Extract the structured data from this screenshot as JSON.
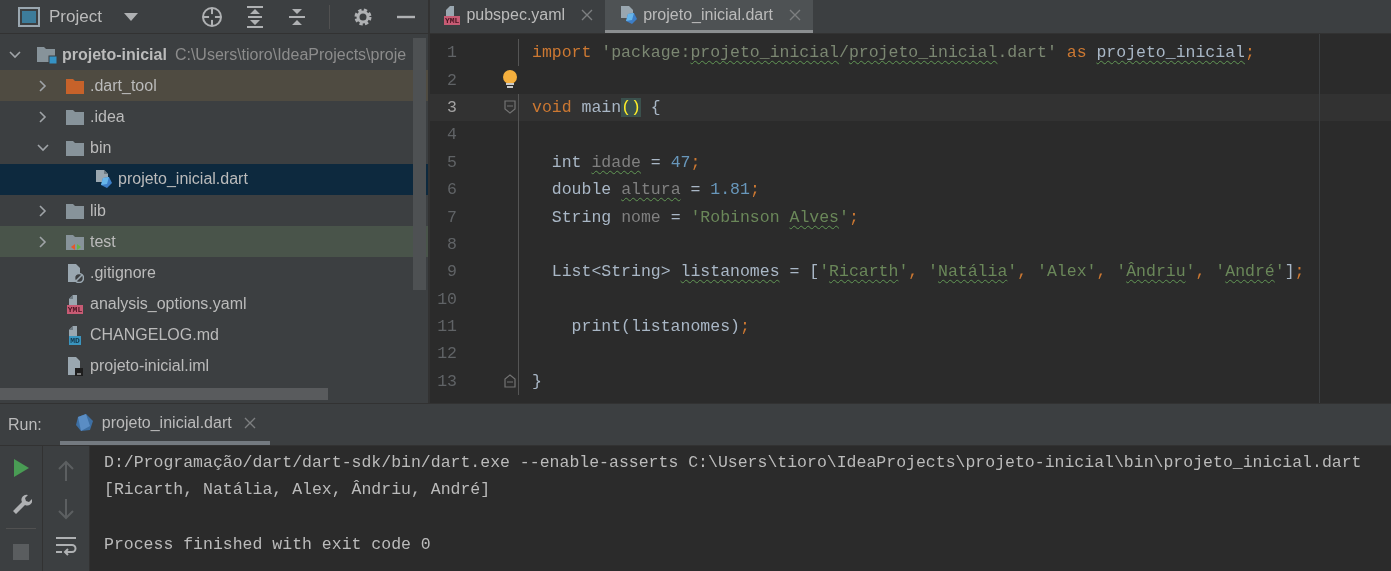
{
  "project_panel": {
    "title": "Project",
    "tree": [
      {
        "kind": "project",
        "name": "projeto-inicial",
        "path": "C:\\Users\\tioro\\IdeaProjects\\proje",
        "expanded": true,
        "selected": false,
        "children": [
          {
            "kind": "excluded-folder",
            "name": ".dart_tool",
            "expanded": false,
            "selected": false
          },
          {
            "kind": "folder",
            "name": ".idea",
            "expanded": false,
            "selected": false
          },
          {
            "kind": "folder",
            "name": "bin",
            "expanded": true,
            "selected": false,
            "children": [
              {
                "kind": "dart",
                "name": "projeto_inicial.dart",
                "selected": true
              }
            ]
          },
          {
            "kind": "folder",
            "name": "lib",
            "expanded": false,
            "selected": false
          },
          {
            "kind": "test-folder",
            "name": "test",
            "expanded": false,
            "selected": false
          },
          {
            "kind": "gitignore",
            "name": ".gitignore",
            "selected": false
          },
          {
            "kind": "badge-file",
            "badge": "YML",
            "name": "analysis_options.yaml",
            "selected": false
          },
          {
            "kind": "badge-file",
            "badge": "MD",
            "name": "CHANGELOG.md",
            "selected": false
          },
          {
            "kind": "iml",
            "name": "projeto-inicial.iml",
            "selected": false
          }
        ]
      }
    ]
  },
  "editor": {
    "tabs": [
      {
        "kind": "badge-file",
        "badge": "YML",
        "label": "pubspec.yaml",
        "selected": false
      },
      {
        "kind": "dart",
        "label": "projeto_inicial.dart",
        "selected": true
      }
    ],
    "lines": [
      {
        "number": "1",
        "current": false,
        "tokens": [
          {
            "kind": "keyword",
            "text": "import "
          },
          {
            "kind": "dim-string",
            "text": "'package:"
          },
          {
            "kind": "dim-string",
            "text": "projeto_inicial",
            "typo": true
          },
          {
            "kind": "dim-string",
            "text": "/"
          },
          {
            "kind": "dim-string",
            "text": "projeto_inicial",
            "typo": true
          },
          {
            "kind": "dim-string",
            "text": ".dart'"
          },
          {
            "kind": "keyword",
            "text": " as "
          },
          {
            "kind": "plain",
            "text": "projeto_inicial",
            "typo": true
          },
          {
            "kind": "punct",
            "text": ";"
          }
        ]
      },
      {
        "number": "2",
        "current": false,
        "bulb": true
      },
      {
        "number": "3",
        "current": true,
        "fold_start": true,
        "tokens": [
          {
            "kind": "keyword",
            "text": "void "
          },
          {
            "kind": "plain",
            "text": "main"
          },
          {
            "kind": "brace",
            "text": "()"
          },
          {
            "kind": "plain",
            "text": " {"
          }
        ]
      },
      {
        "number": "4",
        "current": false
      },
      {
        "number": "5",
        "current": false,
        "tokens": [
          {
            "kind": "plain",
            "text": "  int "
          },
          {
            "kind": "unused",
            "text": "idade",
            "typo": true
          },
          {
            "kind": "plain",
            "text": " = "
          },
          {
            "kind": "number",
            "text": "47"
          },
          {
            "kind": "punct",
            "text": ";"
          }
        ]
      },
      {
        "number": "6",
        "current": false,
        "tokens": [
          {
            "kind": "plain",
            "text": "  double "
          },
          {
            "kind": "unused",
            "text": "altura",
            "typo": true
          },
          {
            "kind": "plain",
            "text": " = "
          },
          {
            "kind": "number",
            "text": "1.81"
          },
          {
            "kind": "punct",
            "text": ";"
          }
        ]
      },
      {
        "number": "7",
        "current": false,
        "tokens": [
          {
            "kind": "plain",
            "text": "  String "
          },
          {
            "kind": "unused",
            "text": "nome"
          },
          {
            "kind": "plain",
            "text": " = "
          },
          {
            "kind": "string",
            "text": "'Robinson "
          },
          {
            "kind": "string",
            "text": "Alves",
            "typo": true
          },
          {
            "kind": "string",
            "text": "'"
          },
          {
            "kind": "punct",
            "text": ";"
          }
        ]
      },
      {
        "number": "8",
        "current": false
      },
      {
        "number": "9",
        "current": false,
        "tokens": [
          {
            "kind": "plain",
            "text": "  List<String> "
          },
          {
            "kind": "plain",
            "text": "listanomes",
            "typo": true
          },
          {
            "kind": "plain",
            "text": " = ["
          },
          {
            "kind": "string",
            "text": "'"
          },
          {
            "kind": "string",
            "text": "Ricarth",
            "typo": true
          },
          {
            "kind": "string",
            "text": "'"
          },
          {
            "kind": "punct",
            "text": ", "
          },
          {
            "kind": "string",
            "text": "'"
          },
          {
            "kind": "string",
            "text": "Natália",
            "typo": true
          },
          {
            "kind": "string",
            "text": "'"
          },
          {
            "kind": "punct",
            "text": ", "
          },
          {
            "kind": "string",
            "text": "'Alex'"
          },
          {
            "kind": "punct",
            "text": ", "
          },
          {
            "kind": "string",
            "text": "'"
          },
          {
            "kind": "string",
            "text": "Ândriu",
            "typo": true
          },
          {
            "kind": "string",
            "text": "'"
          },
          {
            "kind": "punct",
            "text": ", "
          },
          {
            "kind": "string",
            "text": "'"
          },
          {
            "kind": "string",
            "text": "André",
            "typo": true
          },
          {
            "kind": "string",
            "text": "'"
          },
          {
            "kind": "plain",
            "text": "]"
          },
          {
            "kind": "punct",
            "text": ";"
          }
        ]
      },
      {
        "number": "10",
        "current": false
      },
      {
        "number": "11",
        "current": false,
        "tokens": [
          {
            "kind": "plain",
            "text": "    print(listanomes)"
          },
          {
            "kind": "punct",
            "text": ";"
          }
        ]
      },
      {
        "number": "12",
        "current": false
      },
      {
        "number": "13",
        "current": false,
        "fold_end": true,
        "tokens": [
          {
            "kind": "plain",
            "text": "}"
          }
        ]
      }
    ]
  },
  "run_panel": {
    "label": "Run:",
    "tabs": [
      {
        "label": "projeto_inicial.dart",
        "selected": true
      }
    ],
    "console": [
      {
        "kind": "command",
        "text": "D:/Programação/dart/dart-sdk/bin/dart.exe --enable-asserts C:\\Users\\tioro\\IdeaProjects\\projeto-inicial\\bin\\projeto_inicial.dart"
      },
      {
        "kind": "output",
        "text": "[Ricarth, Natália, Alex, Ândriu, André]"
      },
      {
        "kind": "exit",
        "text": "Process finished with exit code 0"
      }
    ]
  }
}
